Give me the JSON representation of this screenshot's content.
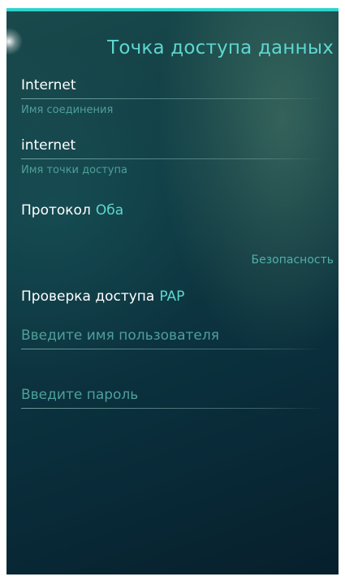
{
  "header": {
    "title": "Точка доступа данных"
  },
  "connection_name": {
    "value": "Internet",
    "label": "Имя соединения"
  },
  "access_point_name": {
    "value": "internet",
    "label": "Имя точки доступа"
  },
  "protocol": {
    "label": "Протокол",
    "value": "Оба"
  },
  "security": {
    "section_title": "Безопасность",
    "auth": {
      "label": "Проверка доступа",
      "value": "PAP"
    },
    "username": {
      "placeholder": "Введите имя пользователя"
    },
    "password": {
      "placeholder": "Введите пароль"
    }
  },
  "colors": {
    "accent": "#5ed7cf",
    "topbar": "#2ad4cc",
    "hint": "#4f9f9a"
  }
}
